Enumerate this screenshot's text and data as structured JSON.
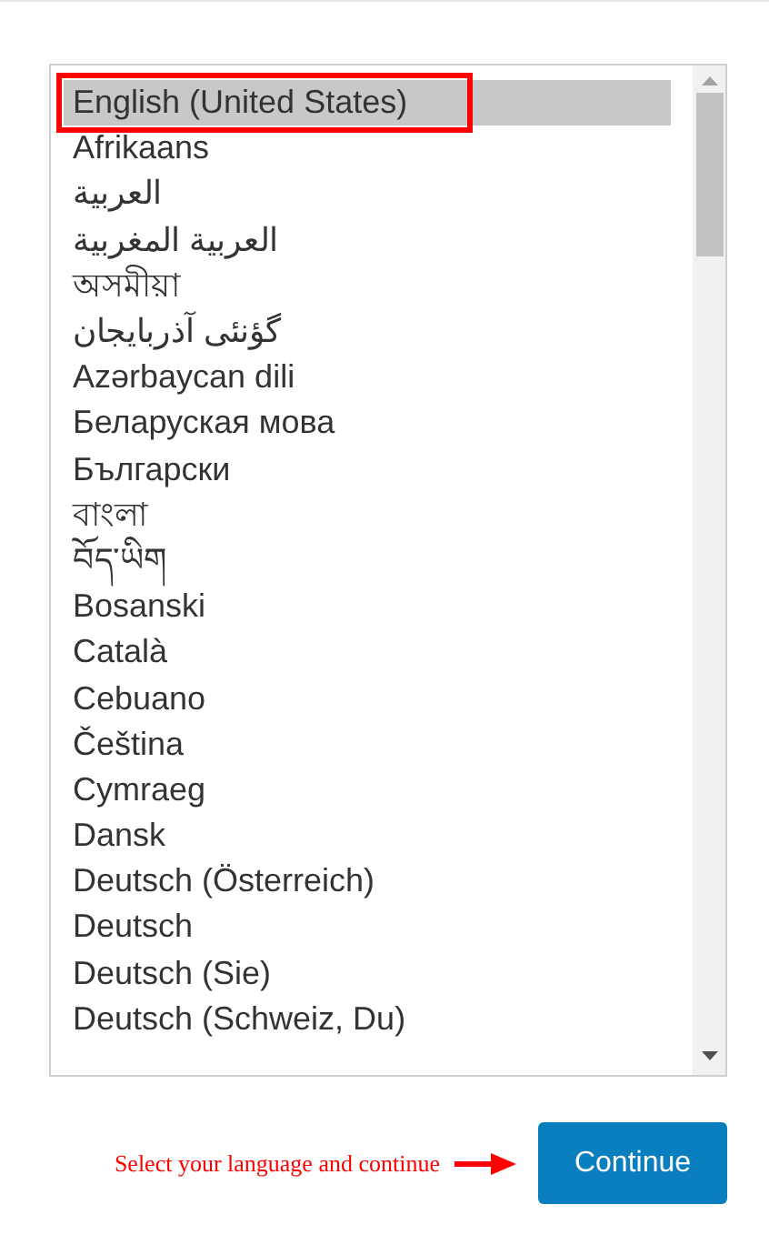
{
  "language_list": {
    "items": [
      {
        "label": "English (United States)",
        "selected": true,
        "annotated": true
      },
      {
        "label": "Afrikaans",
        "selected": false,
        "annotated": false
      },
      {
        "label": "العربية",
        "selected": false,
        "annotated": false
      },
      {
        "label": "العربية المغربية",
        "selected": false,
        "annotated": false
      },
      {
        "label": "অসমীয়া",
        "selected": false,
        "annotated": false
      },
      {
        "label": "گؤنئی آذربایجان",
        "selected": false,
        "annotated": false
      },
      {
        "label": "Azərbaycan dili",
        "selected": false,
        "annotated": false
      },
      {
        "label": "Беларуская мова",
        "selected": false,
        "annotated": false
      },
      {
        "label": "Български",
        "selected": false,
        "annotated": false
      },
      {
        "label": "বাংলা",
        "selected": false,
        "annotated": false
      },
      {
        "label": "བོད་ཡིག",
        "selected": false,
        "annotated": false
      },
      {
        "label": "Bosanski",
        "selected": false,
        "annotated": false
      },
      {
        "label": "Català",
        "selected": false,
        "annotated": false
      },
      {
        "label": "Cebuano",
        "selected": false,
        "annotated": false
      },
      {
        "label": "Čeština",
        "selected": false,
        "annotated": false
      },
      {
        "label": "Cymraeg",
        "selected": false,
        "annotated": false
      },
      {
        "label": "Dansk",
        "selected": false,
        "annotated": false
      },
      {
        "label": "Deutsch (Österreich)",
        "selected": false,
        "annotated": false
      },
      {
        "label": "Deutsch",
        "selected": false,
        "annotated": false
      },
      {
        "label": "Deutsch (Sie)",
        "selected": false,
        "annotated": false
      },
      {
        "label": "Deutsch (Schweiz, Du)",
        "selected": false,
        "annotated": false
      }
    ]
  },
  "hint": "Select your language and continue",
  "continue_button": "Continue"
}
